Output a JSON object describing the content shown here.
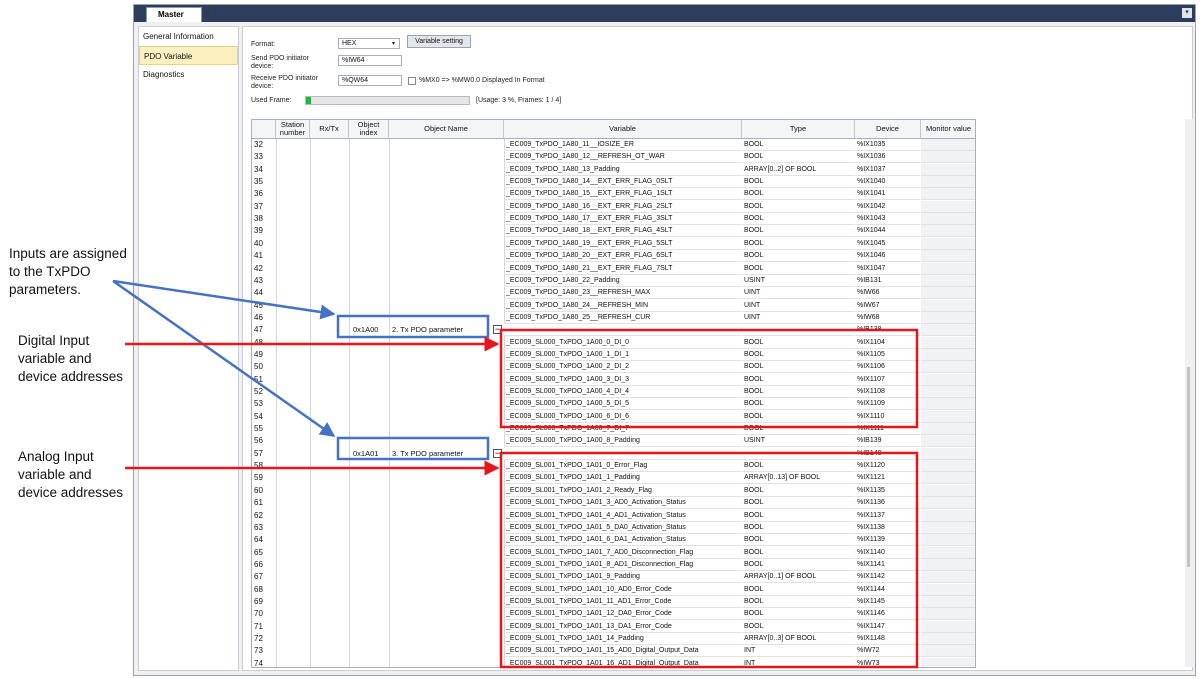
{
  "window": {
    "tab_label": "Master",
    "tab_close": "×",
    "dropdown": "▾"
  },
  "sidebar": {
    "items": [
      {
        "label": "General Information",
        "selected": false
      },
      {
        "label": "PDO Variable",
        "selected": true
      },
      {
        "label": "Diagnostics",
        "selected": false
      }
    ]
  },
  "settings": {
    "format_label": "Format:",
    "format_value": "HEX",
    "format_arrow": "▾",
    "variable_setting_button": "Variable setting",
    "send_label_1": "Send PDO initiator",
    "send_label_2": "device:",
    "send_value": "%IW64",
    "receive_label_1": "Receive PDO initiator",
    "receive_label_2": "device:",
    "receive_value": "%QW64",
    "mx_checkbox_label": "%MX0 => %MW0.0 Displayed In Format",
    "mx_checked": false,
    "used_frame_label": "Used Frame:",
    "usage_text": "[Usage: 3 %, Frames: 1 / 4]",
    "usage_percent": 3,
    "usage_color": "#21b53a"
  },
  "table": {
    "headers": {
      "station_1": "Station",
      "station_2": "number",
      "rxtx": "Rx/Tx",
      "object_index_1": "Object",
      "object_index_2": "index",
      "object_name": "Object Name",
      "variable": "Variable",
      "type": "Type",
      "device": "Device",
      "monitor": "Monitor value"
    },
    "rows": [
      {
        "n": "32",
        "variable": "_EC009_TxPDO_1A80_11__IOSIZE_ER",
        "type": "BOOL",
        "device": "%IX1035"
      },
      {
        "n": "33",
        "variable": "_EC009_TxPDO_1A80_12__REFRESH_OT_WAR",
        "type": "BOOL",
        "device": "%IX1036"
      },
      {
        "n": "34",
        "variable": "_EC009_TxPDO_1A80_13_Padding",
        "type": "ARRAY[0..2] OF BOOL",
        "device": "%IX1037"
      },
      {
        "n": "35",
        "variable": "_EC009_TxPDO_1A80_14__EXT_ERR_FLAG_0SLT",
        "type": "BOOL",
        "device": "%IX1040"
      },
      {
        "n": "36",
        "variable": "_EC009_TxPDO_1A80_15__EXT_ERR_FLAG_1SLT",
        "type": "BOOL",
        "device": "%IX1041"
      },
      {
        "n": "37",
        "variable": "_EC009_TxPDO_1A80_16__EXT_ERR_FLAG_2SLT",
        "type": "BOOL",
        "device": "%IX1042"
      },
      {
        "n": "38",
        "variable": "_EC009_TxPDO_1A80_17__EXT_ERR_FLAG_3SLT",
        "type": "BOOL",
        "device": "%IX1043"
      },
      {
        "n": "39",
        "variable": "_EC009_TxPDO_1A80_18__EXT_ERR_FLAG_4SLT",
        "type": "BOOL",
        "device": "%IX1044"
      },
      {
        "n": "40",
        "variable": "_EC009_TxPDO_1A80_19__EXT_ERR_FLAG_5SLT",
        "type": "BOOL",
        "device": "%IX1045"
      },
      {
        "n": "41",
        "variable": "_EC009_TxPDO_1A80_20__EXT_ERR_FLAG_6SLT",
        "type": "BOOL",
        "device": "%IX1046"
      },
      {
        "n": "42",
        "variable": "_EC009_TxPDO_1A80_21__EXT_ERR_FLAG_7SLT",
        "type": "BOOL",
        "device": "%IX1047"
      },
      {
        "n": "43",
        "variable": "_EC009_TxPDO_1A80_22_Padding",
        "type": "USINT",
        "device": "%IB131"
      },
      {
        "n": "44",
        "variable": "_EC009_TxPDO_1A80_23__REFRESH_MAX",
        "type": "UINT",
        "device": "%IW66"
      },
      {
        "n": "45",
        "variable": "_EC009_TxPDO_1A80_24__REFRESH_MIN",
        "type": "UINT",
        "device": "%IW67"
      },
      {
        "n": "46",
        "variable": "_EC009_TxPDO_1A80_25__REFRESH_CUR",
        "type": "UINT",
        "device": "%IW68"
      },
      {
        "n": "47",
        "variable": "",
        "type": "",
        "device": "%IB138",
        "object_index": "0x1A00",
        "object_name": "2. Tx PDO parameter",
        "collapse": "−"
      },
      {
        "n": "48",
        "variable": "_EC009_SL000_TxPDO_1A00_0_DI_0",
        "type": "BOOL",
        "device": "%IX1104"
      },
      {
        "n": "49",
        "variable": "_EC009_SL000_TxPDO_1A00_1_DI_1",
        "type": "BOOL",
        "device": "%IX1105"
      },
      {
        "n": "50",
        "variable": "_EC009_SL000_TxPDO_1A00_2_DI_2",
        "type": "BOOL",
        "device": "%IX1106"
      },
      {
        "n": "51",
        "variable": "_EC009_SL000_TxPDO_1A00_3_DI_3",
        "type": "BOOL",
        "device": "%IX1107"
      },
      {
        "n": "52",
        "variable": "_EC009_SL000_TxPDO_1A00_4_DI_4",
        "type": "BOOL",
        "device": "%IX1108"
      },
      {
        "n": "53",
        "variable": "_EC009_SL000_TxPDO_1A00_5_DI_5",
        "type": "BOOL",
        "device": "%IX1109"
      },
      {
        "n": "54",
        "variable": "_EC009_SL000_TxPDO_1A00_6_DI_6",
        "type": "BOOL",
        "device": "%IX1110"
      },
      {
        "n": "55",
        "variable": "_EC009_SL000_TxPDO_1A00_7_DI_7",
        "type": "BOOL",
        "device": "%IX1111"
      },
      {
        "n": "56",
        "variable": "_EC009_SL000_TxPDO_1A00_8_Padding",
        "type": "USINT",
        "device": "%IB139"
      },
      {
        "n": "57",
        "variable": "",
        "type": "",
        "device": "%IB140",
        "object_index": "0x1A01",
        "object_name": "3. Tx PDO parameter",
        "collapse": "−"
      },
      {
        "n": "58",
        "variable": "_EC009_SL001_TxPDO_1A01_0_Error_Flag",
        "type": "BOOL",
        "device": "%IX1120"
      },
      {
        "n": "59",
        "variable": "_EC009_SL001_TxPDO_1A01_1_Padding",
        "type": "ARRAY[0..13] OF BOOL",
        "device": "%IX1121"
      },
      {
        "n": "60",
        "variable": "_EC009_SL001_TxPDO_1A01_2_Ready_Flag",
        "type": "BOOL",
        "device": "%IX1135"
      },
      {
        "n": "61",
        "variable": "_EC009_SL001_TxPDO_1A01_3_AD0_Activation_Status",
        "type": "BOOL",
        "device": "%IX1136"
      },
      {
        "n": "62",
        "variable": "_EC009_SL001_TxPDO_1A01_4_AD1_Activation_Status",
        "type": "BOOL",
        "device": "%IX1137"
      },
      {
        "n": "63",
        "variable": "_EC009_SL001_TxPDO_1A01_5_DA0_Activation_Status",
        "type": "BOOL",
        "device": "%IX1138"
      },
      {
        "n": "64",
        "variable": "_EC009_SL001_TxPDO_1A01_6_DA1_Activation_Status",
        "type": "BOOL",
        "device": "%IX1139"
      },
      {
        "n": "65",
        "variable": "_EC009_SL001_TxPDO_1A01_7_AD0_Disconnection_Flag",
        "type": "BOOL",
        "device": "%IX1140"
      },
      {
        "n": "66",
        "variable": "_EC009_SL001_TxPDO_1A01_8_AD1_Disconnection_Flag",
        "type": "BOOL",
        "device": "%IX1141"
      },
      {
        "n": "67",
        "variable": "_EC009_SL001_TxPDO_1A01_9_Padding",
        "type": "ARRAY[0..1] OF BOOL",
        "device": "%IX1142"
      },
      {
        "n": "68",
        "variable": "_EC009_SL001_TxPDO_1A01_10_AD0_Error_Code",
        "type": "BOOL",
        "device": "%IX1144"
      },
      {
        "n": "69",
        "variable": "_EC009_SL001_TxPDO_1A01_11_AD1_Error_Code",
        "type": "BOOL",
        "device": "%IX1145"
      },
      {
        "n": "70",
        "variable": "_EC009_SL001_TxPDO_1A01_12_DA0_Error_Code",
        "type": "BOOL",
        "device": "%IX1146"
      },
      {
        "n": "71",
        "variable": "_EC009_SL001_TxPDO_1A01_13_DA1_Error_Code",
        "type": "BOOL",
        "device": "%IX1147"
      },
      {
        "n": "72",
        "variable": "_EC009_SL001_TxPDO_1A01_14_Padding",
        "type": "ARRAY[0..3] OF BOOL",
        "device": "%IX1148"
      },
      {
        "n": "73",
        "variable": "_EC009_SL001_TxPDO_1A01_15_AD0_Digital_Output_Data",
        "type": "INT",
        "device": "%IW72"
      },
      {
        "n": "74",
        "variable": "_EC009_SL001_TxPDO_1A01_16_AD1_Digital_Output_Data",
        "type": "INT",
        "device": "%IW73"
      }
    ]
  },
  "annotations": {
    "inputs_note": [
      "Inputs are assigned",
      "to the TxPDO",
      "parameters."
    ],
    "digital_note": [
      "Digital Input",
      "variable and",
      "device addresses"
    ],
    "analog_note": [
      "Analog Input",
      "variable and",
      "device addresses"
    ],
    "blue_color": "#4472c4",
    "red_color": "#e8151b"
  }
}
